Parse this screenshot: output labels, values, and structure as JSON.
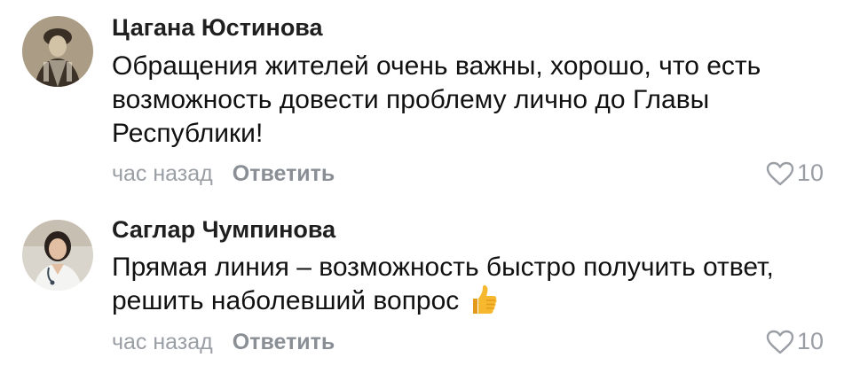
{
  "comments": [
    {
      "author": "Цагана Юстинова",
      "text_lines": [
        "Обращения жителей очень важны, хорошо, что есть",
        "возможность довести проблему лично до Главы",
        "Республики!"
      ],
      "time": "час назад",
      "reply_label": "Ответить",
      "likes": "10",
      "avatar": "avatar-photo-vintage"
    },
    {
      "author": "Саглар Чумпинова",
      "text_lines": [
        "Прямая линия – возможность быстро получить ответ,",
        "решить наболевший вопрос"
      ],
      "emoji": "thumbs-up-icon",
      "time": "час назад",
      "reply_label": "Ответить",
      "likes": "10",
      "avatar": "avatar-photo-doctor"
    }
  ],
  "colors": {
    "author": "#1f1f1f",
    "text": "#111111",
    "muted": "#9a9ea5",
    "reply": "#8a8f96",
    "thumb": "#f5b82e"
  }
}
